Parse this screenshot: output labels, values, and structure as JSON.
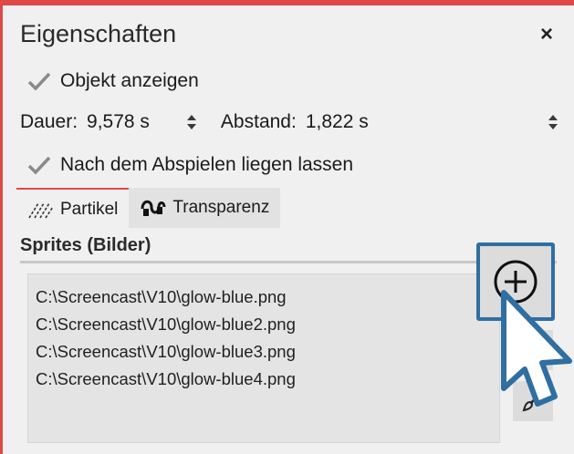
{
  "panel": {
    "title": "Eigenschaften",
    "close_glyph": "×"
  },
  "show_object": {
    "label": "Objekt anzeigen",
    "checked": true
  },
  "timing": {
    "dauer_label": "Dauer:",
    "dauer_value": "9,578 s",
    "abstand_label": "Abstand:",
    "abstand_value": "1,822 s"
  },
  "stay_after_play": {
    "label": "Nach dem Abspielen liegen lassen",
    "checked": true
  },
  "tabs": [
    {
      "label": "Partikel",
      "icon": "particles-icon",
      "active": true
    },
    {
      "label": "Transparenz",
      "icon": "transparency-icon",
      "active": false
    }
  ],
  "sprites": {
    "title": "Sprites (Bilder)",
    "items": [
      "C:\\Screencast\\V10\\glow-blue.png",
      "C:\\Screencast\\V10\\glow-blue2.png",
      "C:\\Screencast\\V10\\glow-blue3.png",
      "C:\\Screencast\\V10\\glow-blue4.png"
    ]
  },
  "colors": {
    "accent_red": "#e04848",
    "focus_blue": "#2f6fa2",
    "list_bg": "#e4e4e4"
  }
}
